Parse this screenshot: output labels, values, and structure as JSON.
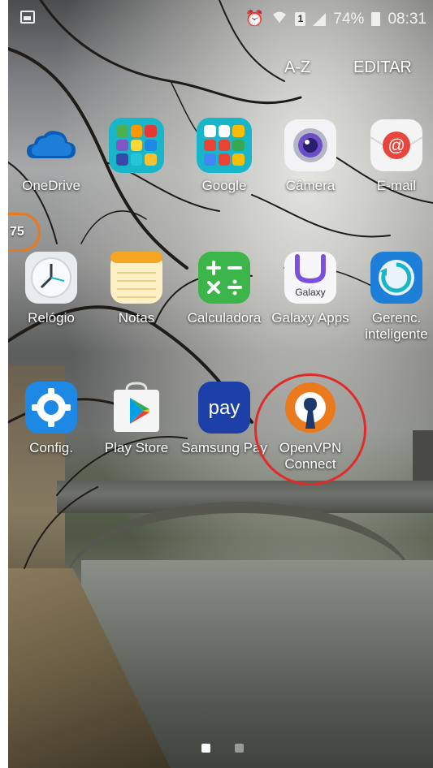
{
  "status_bar": {
    "left_icon": "gallery-icon",
    "alarm_icon": "alarm-clock-icon",
    "wifi_icon": "wifi-icon",
    "sim_label": "1",
    "battery": "74%",
    "time": "08:31"
  },
  "top_actions": {
    "sort_label": "A-Z",
    "edit_label": "EDITAR"
  },
  "badge": {
    "value": "75",
    "color": "#e77a1e"
  },
  "apps": [
    {
      "label": "OneDrive",
      "icon": "onedrive-cloud-icon"
    },
    {
      "label": "",
      "icon": "microsoft-apps-folder-icon"
    },
    {
      "label": "Google",
      "icon": "google-apps-folder-icon"
    },
    {
      "label": "Câmera",
      "icon": "camera-icon"
    },
    {
      "label": "E-mail",
      "icon": "email-at-icon"
    },
    {
      "label": "Relógio",
      "icon": "clock-icon"
    },
    {
      "label": "Notas",
      "icon": "notes-icon"
    },
    {
      "label": "Calculadora",
      "icon": "calculator-icon"
    },
    {
      "label": "Galaxy Apps",
      "icon": "galaxy-apps-icon",
      "icon_text": "Galaxy"
    },
    {
      "label": "Gerenc. inteligente",
      "icon": "smart-manager-icon"
    },
    {
      "label": "Config.",
      "icon": "settings-gear-icon"
    },
    {
      "label": "Play Store",
      "icon": "play-store-icon"
    },
    {
      "label": "Samsung Pay",
      "icon": "samsung-pay-icon",
      "icon_text": "pay"
    },
    {
      "label": "OpenVPN Connect",
      "icon": "openvpn-icon"
    }
  ],
  "annotation": {
    "color": "#e22a2a"
  },
  "pager": {
    "pages": 2,
    "active": 1
  }
}
